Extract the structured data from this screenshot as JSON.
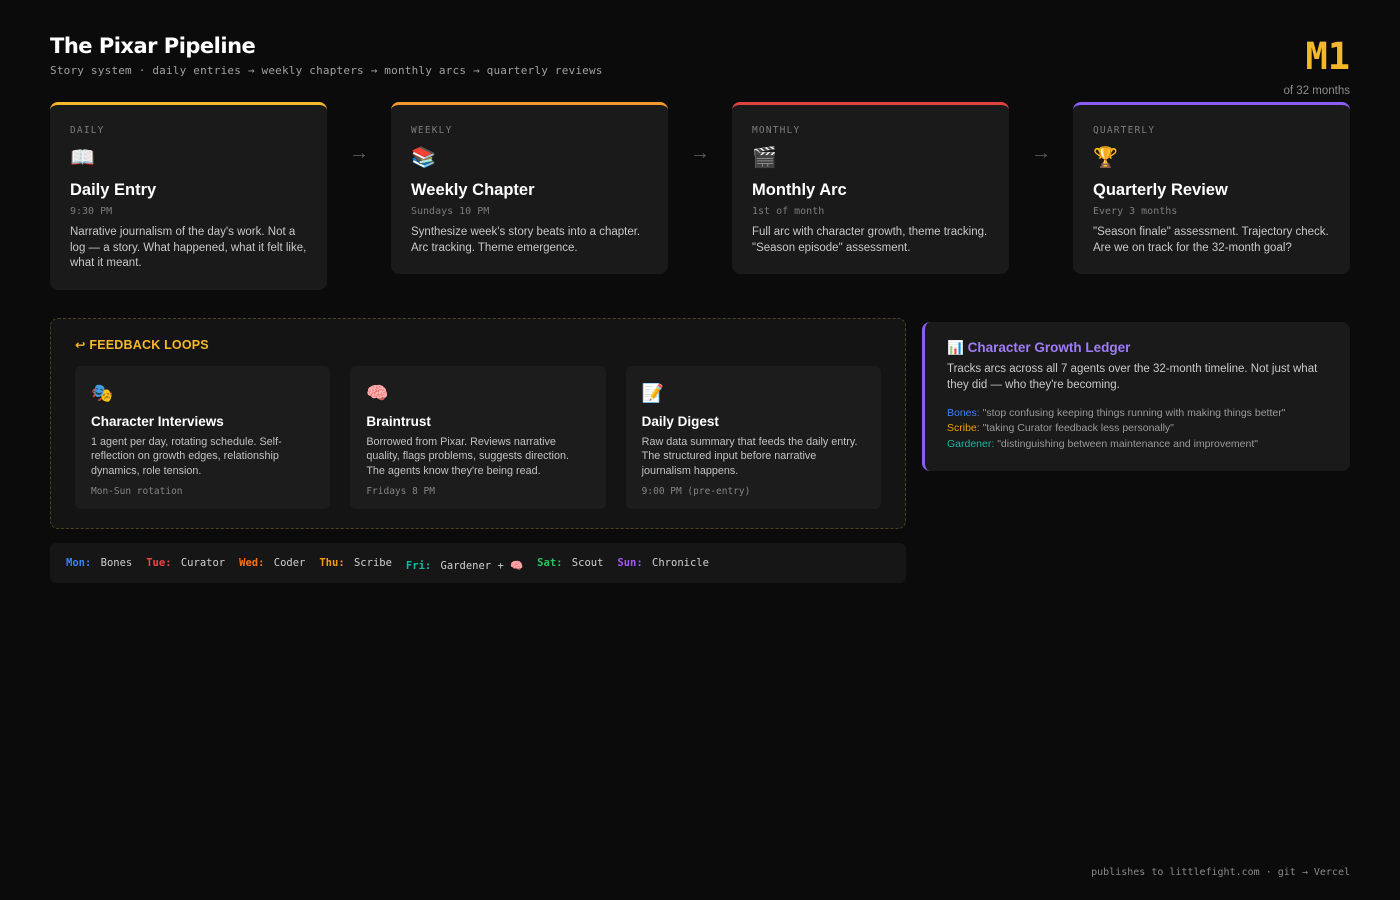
{
  "header": {
    "title": "The Pixar Pipeline",
    "subtitle": "Story system · daily entries → weekly chapters → monthly arcs → quarterly reviews",
    "month": "M1",
    "month_of": "of 32 months"
  },
  "pipeline": {
    "arrow": "→",
    "stages": [
      {
        "tag": "DAILY",
        "icon": "📖",
        "icon_name": "open-book-icon",
        "name": "Daily Entry",
        "time": "9:30 PM",
        "desc": "Narrative journalism of the day's work. Not a log — a story. What happened, what it felt like, what it meant.",
        "color": "#f5b82a"
      },
      {
        "tag": "WEEKLY",
        "icon": "📚",
        "icon_name": "books-icon",
        "name": "Weekly Chapter",
        "time": "Sundays 10 PM",
        "desc": "Synthesize week's story beats into a chapter. Arc tracking. Theme emergence.",
        "color": "#f29a2e"
      },
      {
        "tag": "MONTHLY",
        "icon": "🎬",
        "icon_name": "clapperboard-icon",
        "name": "Monthly Arc",
        "time": "1st of month",
        "desc": "Full arc with character growth, theme tracking. \"Season episode\" assessment.",
        "color": "#e0433f"
      },
      {
        "tag": "QUARTERLY",
        "icon": "🏆",
        "icon_name": "trophy-icon",
        "name": "Quarterly Review",
        "time": "Every 3 months",
        "desc": "\"Season finale\" assessment. Trajectory check. Are we on track for the 32-month goal?",
        "color": "#8b5cf6"
      }
    ]
  },
  "feedback": {
    "icon": "↩",
    "title": "FEEDBACK LOOPS",
    "loops": [
      {
        "icon": "🎭",
        "icon_name": "theater-masks-icon",
        "name": "Character Interviews",
        "desc": "1 agent per day, rotating schedule. Self-reflection on growth edges, relationship dynamics, role tension.",
        "meta": "Mon-Sun rotation"
      },
      {
        "icon": "🧠",
        "icon_name": "brain-icon",
        "name": "Braintrust",
        "desc": "Borrowed from Pixar. Reviews narrative quality, flags problems, suggests direction. The agents know they're being read.",
        "meta": "Fridays 8 PM"
      },
      {
        "icon": "📝",
        "icon_name": "memo-icon",
        "name": "Daily Digest",
        "desc": "Raw data summary that feeds the daily entry. The structured input before narrative journalism happens.",
        "meta": "9:00 PM (pre-entry)"
      }
    ]
  },
  "rotation": [
    {
      "day": "Mon:",
      "agent": "Bones",
      "color": "#3b82f6"
    },
    {
      "day": "Tue:",
      "agent": "Curator",
      "color": "#ef4444"
    },
    {
      "day": "Wed:",
      "agent": "Coder",
      "color": "#f97316"
    },
    {
      "day": "Thu:",
      "agent": "Scribe",
      "color": "#f59e0b"
    },
    {
      "day": "Fri:",
      "agent": "Gardener + 🧠",
      "color": "#14b8a6"
    },
    {
      "day": "Sat:",
      "agent": "Scout",
      "color": "#22c55e"
    },
    {
      "day": "Sun:",
      "agent": "Chronicle",
      "color": "#a855f7"
    }
  ],
  "ledger": {
    "icon": "📊",
    "icon_name": "bar-chart-icon",
    "title": "Character Growth Ledger",
    "desc": "Tracks arcs across all 7 agents over the 32-month timeline. Not just what they did — who they're becoming.",
    "quotes": [
      {
        "agent": "Bones:",
        "quote": "\"stop confusing keeping things running with making things better\"",
        "color": "#3b82f6"
      },
      {
        "agent": "Scribe:",
        "quote": "\"taking Curator feedback less personally\"",
        "color": "#f59e0b"
      },
      {
        "agent": "Gardener:",
        "quote": "\"distinguishing between maintenance and improvement\"",
        "color": "#14b8a6"
      }
    ]
  },
  "footer": "publishes to littlefight.com · git → Vercel"
}
